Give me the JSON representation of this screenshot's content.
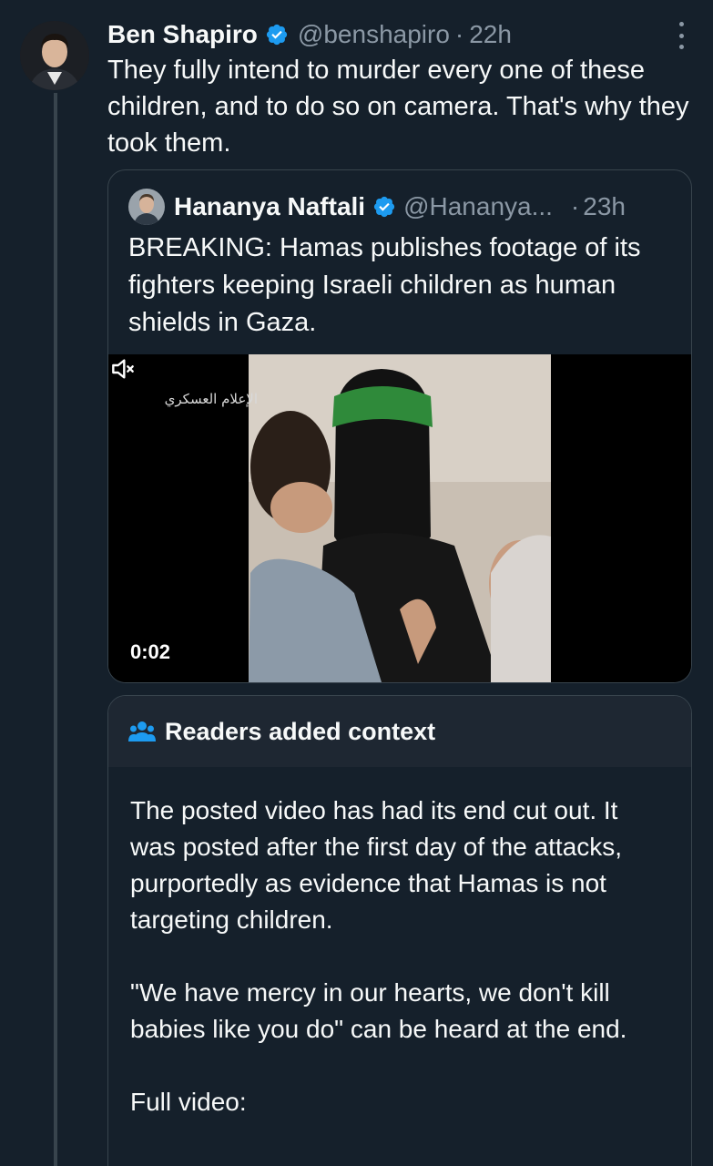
{
  "tweet": {
    "author_name": "Ben Shapiro",
    "author_handle": "@benshapiro",
    "separator": "·",
    "time": "22h",
    "text": "They fully intend to murder every one of these children, and to do so on camera. That's why they took them."
  },
  "quoted_tweet": {
    "author_name": "Hananya Naftali",
    "author_handle": "@Hananya...",
    "separator": "·",
    "time": "23h",
    "text": "BREAKING: Hamas publishes footage of its fighters keeping Israeli children as human shields in Gaza.",
    "video": {
      "watermark_text": "الإعلام العسكري",
      "time_display": "0:02",
      "muted": true
    }
  },
  "community_note": {
    "title": "Readers added context",
    "paragraphs": [
      "The posted video has had its end cut out. It was posted after the first day of the attacks, purportedly as evidence that Hamas is not targeting children.",
      "\"We have mercy in our hearts, we don't kill babies like you do\" can be heard at the end.",
      "Full video:"
    ]
  },
  "icons": {
    "verified": "verified-badge-icon",
    "more": "more-vertical-icon",
    "mute": "volume-muted-icon",
    "readers": "people-group-icon"
  },
  "colors": {
    "background": "#15202b",
    "verified_blue": "#1d9bf0",
    "secondary_text": "#8b98a5",
    "border": "#38444d",
    "note_header_bg": "#1e2732"
  }
}
